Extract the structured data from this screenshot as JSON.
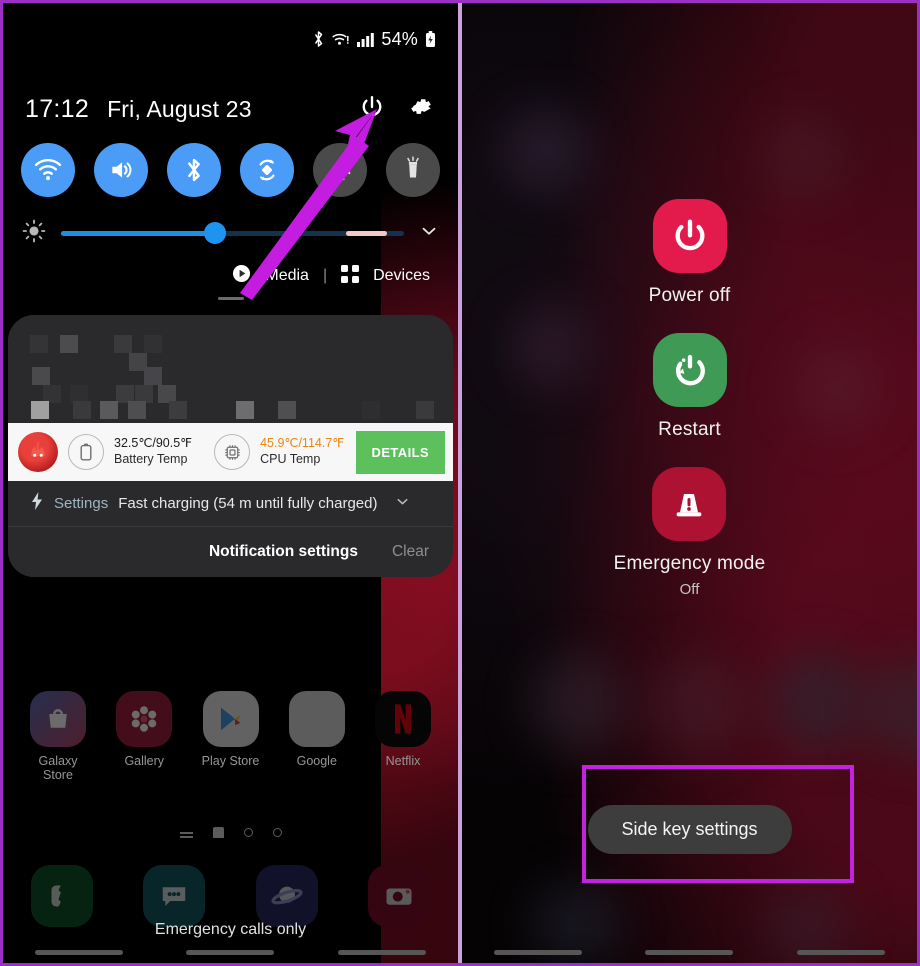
{
  "statusbar": {
    "bluetooth_icon": "bluetooth-icon",
    "wifi_icon": "wifi-icon",
    "signal_icon": "cellular-signal-icon",
    "battery_percent": "54%",
    "battery_icon": "battery-charging-icon"
  },
  "quick_settings": {
    "time": "17:12",
    "date": "Fri, August 23",
    "power_icon": "power-icon",
    "settings_icon": "gear-icon",
    "toggles": [
      {
        "name": "wifi",
        "icon": "wifi-icon",
        "state": "on"
      },
      {
        "name": "sound",
        "icon": "volume-icon",
        "state": "on"
      },
      {
        "name": "bluetooth",
        "icon": "bluetooth-icon",
        "state": "on"
      },
      {
        "name": "auto-rotate",
        "icon": "auto-rotate-icon",
        "state": "on"
      },
      {
        "name": "airplane-mode",
        "icon": "airplane-icon",
        "state": "off"
      },
      {
        "name": "flashlight",
        "icon": "flashlight-icon",
        "state": "off"
      }
    ],
    "brightness": {
      "icon": "brightness-icon",
      "value_percent": 45,
      "expand_icon": "chevron-down-icon"
    },
    "media_label": "Media",
    "media_icon": "play-circle-icon",
    "separator": "|",
    "devices_label": "Devices",
    "devices_icon": "devices-grid-icon"
  },
  "notifications": {
    "antutu": {
      "app_icon": "antutu-flame-icon",
      "battery_icon": "battery-outline-icon",
      "battery_value": "32.5℃/90.5℉",
      "battery_label": "Battery Temp",
      "cpu_icon": "cpu-chip-icon",
      "cpu_value": "45.9℃/114.7℉",
      "cpu_label": "CPU Temp",
      "details_button": "DETAILS",
      "details_color": "#5cc05c",
      "cpu_value_color": "#e8860f"
    },
    "charging": {
      "bolt_icon": "lightning-bolt-icon",
      "source": "Settings",
      "text": "Fast charging (54 m until fully charged)",
      "expand_icon": "chevron-down-icon"
    },
    "footer": {
      "settings_label": "Notification settings",
      "clear_label": "Clear"
    }
  },
  "homescreen": {
    "apps": [
      {
        "label": "Galaxy Store",
        "icon": "galaxy-store-icon"
      },
      {
        "label": "Gallery",
        "icon": "gallery-icon"
      },
      {
        "label": "Play Store",
        "icon": "play-store-icon"
      },
      {
        "label": "Google",
        "icon": "google-folder-icon"
      },
      {
        "label": "Netflix",
        "icon": "netflix-icon"
      }
    ],
    "dock": [
      {
        "label": "Phone",
        "icon": "phone-icon"
      },
      {
        "label": "Messages",
        "icon": "messages-icon"
      },
      {
        "label": "Internet",
        "icon": "internet-icon"
      },
      {
        "label": "Camera",
        "icon": "camera-icon"
      }
    ],
    "carrier_text": "Emergency calls only"
  },
  "power_menu": {
    "items": [
      {
        "label": "Power off",
        "sub": "",
        "icon": "power-icon",
        "color": "#e31b4d"
      },
      {
        "label": "Restart",
        "sub": "",
        "icon": "restart-icon",
        "color": "#3f9a55"
      },
      {
        "label": "Emergency mode",
        "sub": "Off",
        "icon": "emergency-beacon-icon",
        "color": "#ad1232"
      }
    ],
    "side_key_button": "Side key settings"
  },
  "annotations": {
    "arrow_color": "#c41ce0",
    "highlight_color": "#c223e0"
  }
}
